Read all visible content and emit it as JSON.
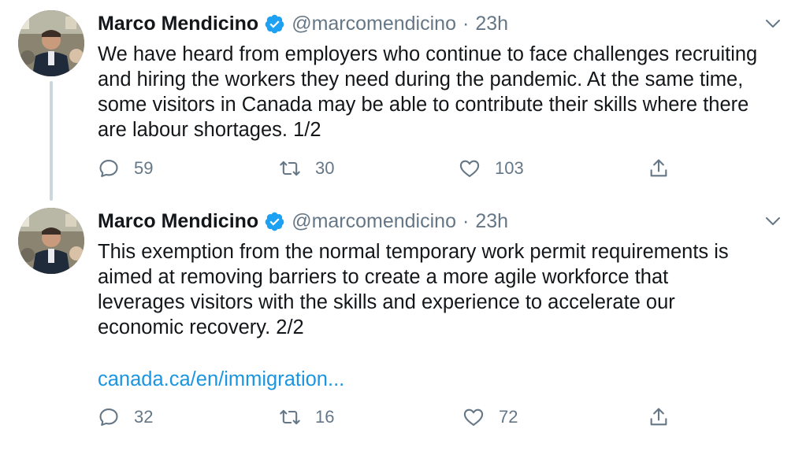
{
  "tweets": [
    {
      "author_name": "Marco Mendicino",
      "handle": "@marcomendicino",
      "separator": "·",
      "time": "23h",
      "text": "We have heard from employers who continue to face challenges recruiting\nand hiring the workers they need during the pandemic. At the same time,\nsome visitors in Canada may be able to contribute their skills where there\nare labour shortages. 1/2",
      "link": "",
      "replies": "59",
      "retweets": "30",
      "likes": "103"
    },
    {
      "author_name": "Marco Mendicino",
      "handle": "@marcomendicino",
      "separator": "·",
      "time": "23h",
      "text": "This exemption from the normal temporary work permit requirements is\naimed at removing barriers to create a more agile workforce that\nleverages visitors with the skills and experience to accelerate our\neconomic recovery. 2/2",
      "link": "canada.ca/en/immigration...",
      "replies": "32",
      "retweets": "16",
      "likes": "72"
    }
  ],
  "icons": {
    "verified": "verified-badge-icon",
    "caret": "chevron-down-icon",
    "reply": "reply-icon",
    "retweet": "retweet-icon",
    "like": "heart-icon",
    "share": "share-icon"
  },
  "colors": {
    "text": "#14171a",
    "muted": "#657786",
    "link": "#1b95e0",
    "verified": "#1da1f2",
    "thread_line": "#ccd6dd"
  }
}
